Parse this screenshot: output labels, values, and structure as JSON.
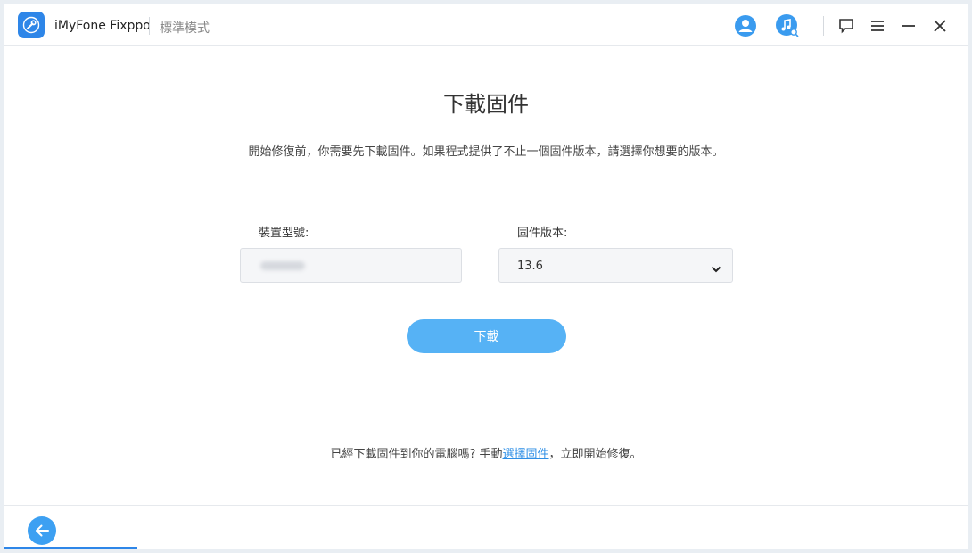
{
  "header": {
    "app_name": "iMyFone Fixppo",
    "mode": "標準模式"
  },
  "icons": {
    "app_logo": "wrench-icon",
    "account": "user-icon",
    "music_search": "music-search-icon",
    "feedback": "chat-icon",
    "menu": "menu-icon",
    "minimize": "minimize-icon",
    "close": "close-icon",
    "back": "back-arrow-icon"
  },
  "main": {
    "title": "下載固件",
    "description": "開始修復前，你需要先下載固件。如果程式提供了不止一個固件版本，請選擇你想要的版本。",
    "model_label": "裝置型號:",
    "firmware_label": "固件版本:",
    "firmware_selected": "13.6",
    "download_label": "下載"
  },
  "footer": {
    "note_prefix": "已經下載固件到你的電腦嗎? 手動",
    "note_link": "選擇固件",
    "note_suffix": "，立即開始修復。"
  },
  "colors": {
    "accent": "#2e86e8",
    "button": "#56b2f5",
    "link": "#2f8fe6"
  }
}
